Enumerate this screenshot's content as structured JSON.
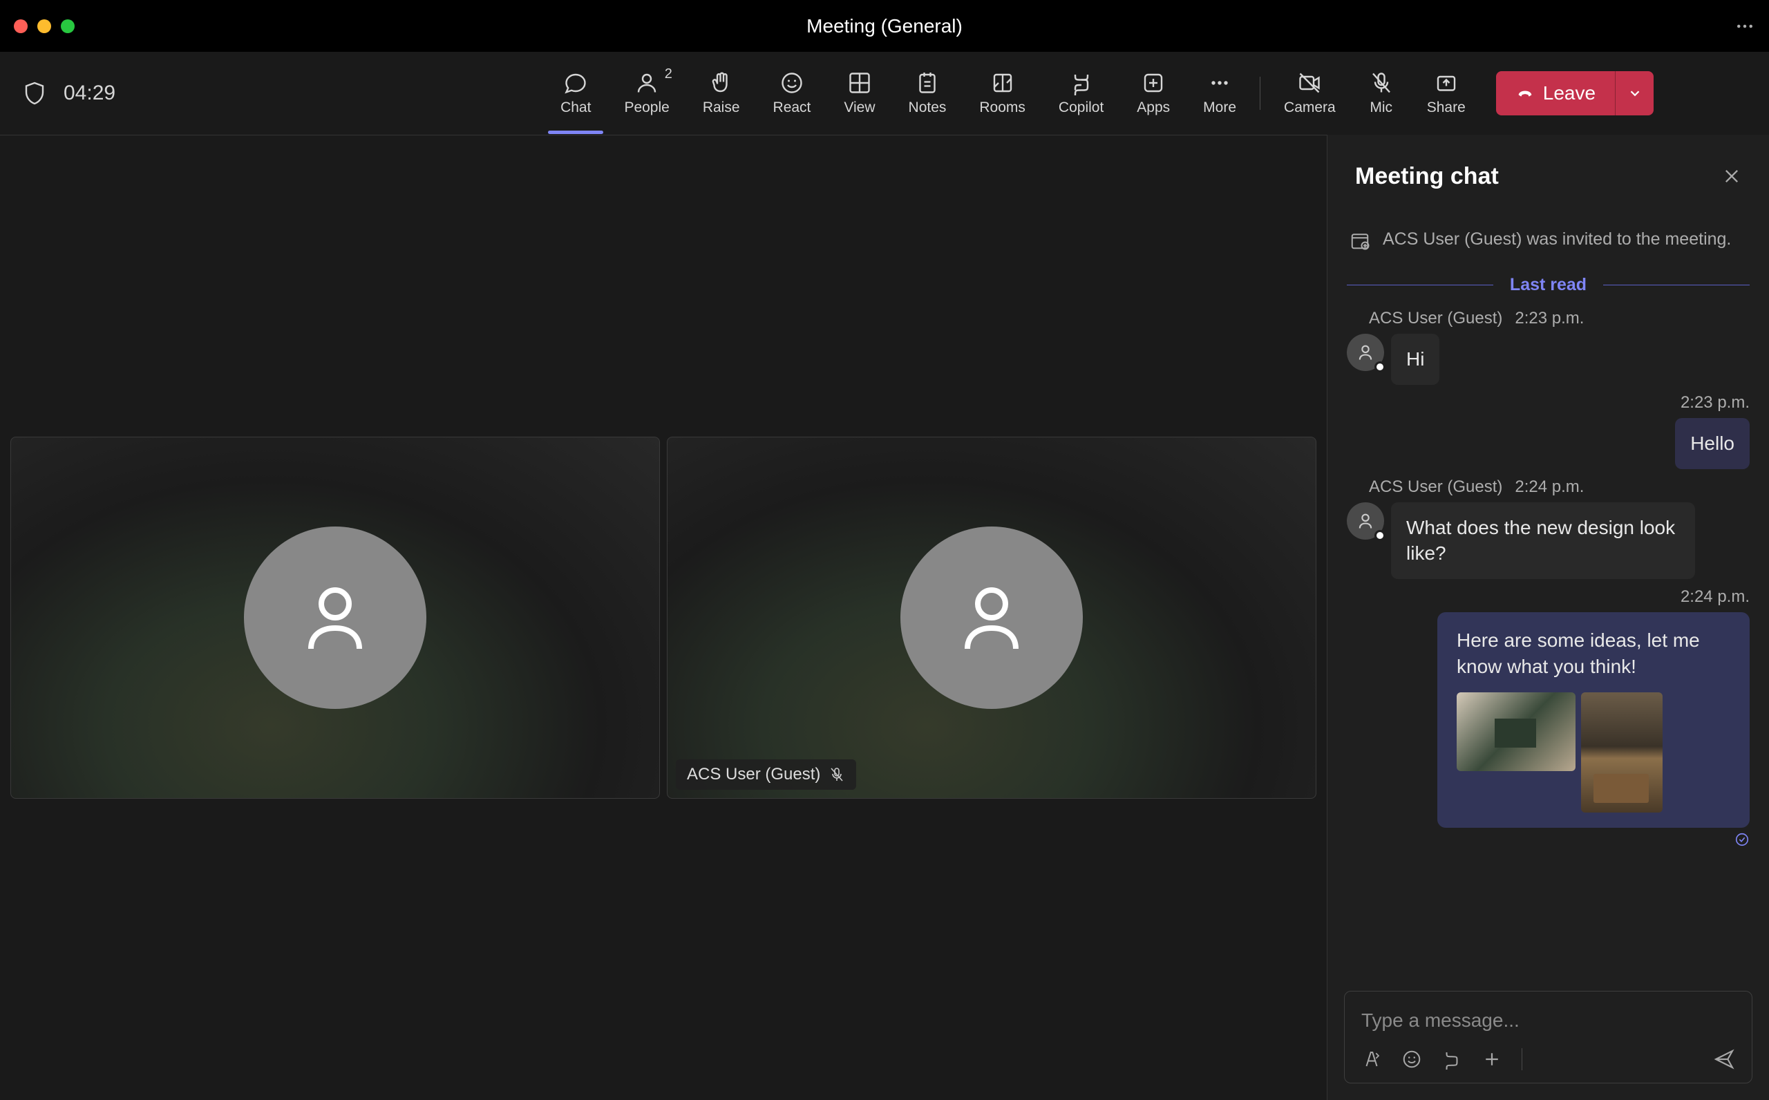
{
  "window": {
    "title": "Meeting (General)"
  },
  "timer": "04:29",
  "toolbar": {
    "chat": "Chat",
    "people": "People",
    "people_count": "2",
    "raise": "Raise",
    "react": "React",
    "view": "View",
    "notes": "Notes",
    "rooms": "Rooms",
    "copilot": "Copilot",
    "apps": "Apps",
    "more": "More",
    "camera": "Camera",
    "mic": "Mic",
    "share": "Share",
    "leave": "Leave"
  },
  "tiles": {
    "remote_name": "ACS User (Guest)"
  },
  "chat": {
    "title": "Meeting chat",
    "system_msg": "ACS User (Guest) was invited to the meeting.",
    "last_read": "Last read",
    "messages": [
      {
        "sender": "ACS User (Guest)",
        "time": "2:23 p.m.",
        "text": "Hi",
        "mine": false
      },
      {
        "time": "2:23 p.m.",
        "text": "Hello",
        "mine": true
      },
      {
        "sender": "ACS User (Guest)",
        "time": "2:24 p.m.",
        "text": "What does the new design look like?",
        "mine": false
      },
      {
        "time": "2:24 p.m.",
        "text": "Here are some ideas, let me know what you think!",
        "mine": true,
        "has_images": true
      }
    ],
    "compose_placeholder": "Type a message..."
  }
}
